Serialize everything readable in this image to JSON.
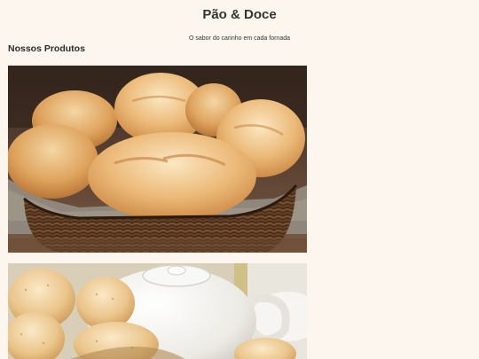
{
  "header": {
    "title": "Pão & Doce",
    "tagline": "O sabor do carinho em cada fornada"
  },
  "products": {
    "section_title": "Nossos Produtos",
    "items": [
      {
        "image_icon": "bread-basket-image"
      },
      {
        "image_icon": "teapot-rolls-image"
      }
    ]
  },
  "colors": {
    "page_background": "#fdf6ef",
    "text": "#333333",
    "bread_crust": "#e2a85a",
    "basket": "#5a3a22"
  }
}
